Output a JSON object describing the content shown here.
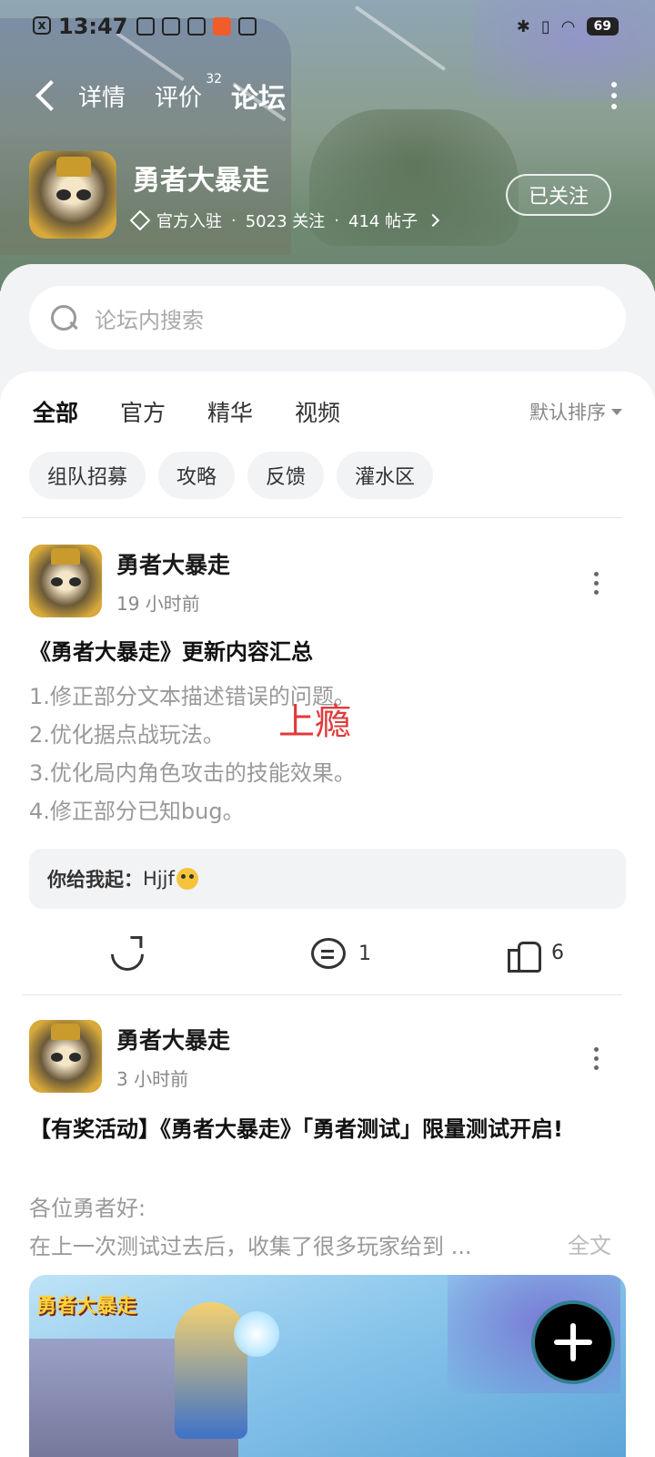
{
  "status_bar": {
    "time": "13:47",
    "battery": "69"
  },
  "nav": {
    "tabs": [
      {
        "label": "详情"
      },
      {
        "label": "评价",
        "badge": "32"
      },
      {
        "label": "论坛"
      }
    ]
  },
  "app": {
    "name": "勇者大暴走",
    "official": "官方入驻",
    "followers": "5023 关注",
    "posts": "414 帖子",
    "follow_label": "已关注"
  },
  "search": {
    "placeholder": "论坛内搜索"
  },
  "filter_tabs": [
    "全部",
    "官方",
    "精华",
    "视频"
  ],
  "sort_label": "默认排序",
  "chips": [
    "组队招募",
    "攻略",
    "反馈",
    "灌水区"
  ],
  "posts": [
    {
      "author": "勇者大暴走",
      "time": "19 小时前",
      "title": "《勇者大暴走》更新内容汇总",
      "lines": [
        "1.修正部分文本描述错误的问题。",
        "2.优化据点战玩法。",
        "3.优化局内角色攻击的技能效果。",
        "4.修正部分已知bug。"
      ],
      "comment": {
        "author": "你给我起：",
        "text": "Hjjf"
      },
      "share_count": "",
      "comment_count": "1",
      "like_count": "6"
    },
    {
      "author": "勇者大暴走",
      "time": "3 小时前",
      "title": "【有奖活动】《勇者大暴走》「勇者测试」限量测试开启!",
      "lines": [
        "各位勇者好:",
        "在上一次测试过去后，收集了很多玩家给到 ..."
      ],
      "fulltext_label": "全文",
      "image_logo": "勇者大暴走"
    }
  ],
  "watermark": "上瘾",
  "colors": {
    "accent": "#2ecfb4",
    "banner": "#8b9e8e",
    "fab": "#000000"
  }
}
